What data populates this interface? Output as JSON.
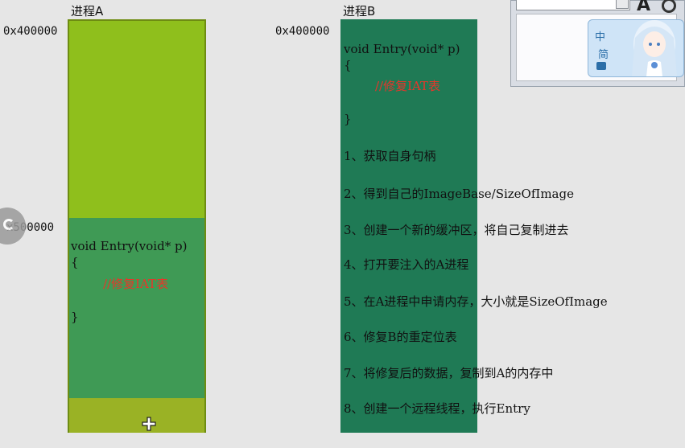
{
  "process_a": {
    "label": "进程A",
    "addr_top": "0x400000",
    "addr_mid": "x500000",
    "code": {
      "line1": "void Entry(void* p)",
      "brace_open": "{",
      "comment": "//修复IAT表",
      "brace_close": "}"
    }
  },
  "process_b": {
    "label": "进程B",
    "addr_top": "0x400000",
    "code": {
      "line1": "void Entry(void* p)",
      "brace_open": "{",
      "comment": "//修复IAT表",
      "brace_close": "}"
    }
  },
  "steps": [
    "1、获取自身句柄",
    "2、得到自己的ImageBase/SizeOfImage",
    "3、创建一个新的缓冲区，将自己复制进去",
    "4、打开要注入的A进程",
    "5、在A进程中申请内存，大小就是SizeOfImage",
    "6、修复B的重定位表",
    "7、将修复后的数据，复制到A的内存中",
    "8、创建一个远程线程，执行Entry"
  ],
  "ime": {
    "mode_label": "中",
    "mode_label2": "简",
    "letter": "A"
  },
  "colors": {
    "block_a_top": "#8fbf1c",
    "block_a_mid": "#3f9a55",
    "block_b": "#1f7a55",
    "comment": "#e8352a"
  }
}
